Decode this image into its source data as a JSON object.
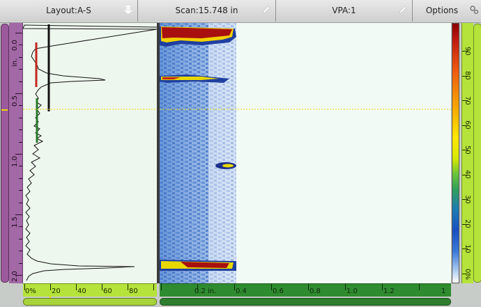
{
  "toolbar": {
    "layout_label": "Layout:A-S",
    "scan_label": "Scan:15.748 in",
    "vpa_label": "VPA:1",
    "options_label": "Options"
  },
  "left_ruler": {
    "unit": "in.",
    "labels": [
      "0.0",
      "0.5",
      "1.0",
      "1.5",
      "2.0"
    ]
  },
  "right_ruler": {
    "labels": [
      "0%",
      "10",
      "20",
      "30",
      "40",
      "50",
      "60",
      "70",
      "80",
      "90"
    ]
  },
  "ascan_ruler": {
    "labels": [
      "0%",
      "20",
      "40",
      "60",
      "80"
    ]
  },
  "sscan_ruler": {
    "unit": "in.",
    "labels": [
      "0.2",
      "0.4",
      "0.6",
      "0.8",
      "1.0",
      "1.2",
      "1"
    ]
  },
  "colors": {
    "gate_a": "#c0281c",
    "gate_b": "#2a7a2a",
    "gate_i": "#111111",
    "cursor": "#e8d800",
    "ruler_depth": "#a368a6",
    "ruler_amp": "#b5e33b",
    "ruler_scan": "#2f8b2f"
  },
  "icons": {
    "layout": "arrow-down-icon",
    "scan": "pencil-icon",
    "vpa": "pencil-icon",
    "options": "gear-icon"
  }
}
